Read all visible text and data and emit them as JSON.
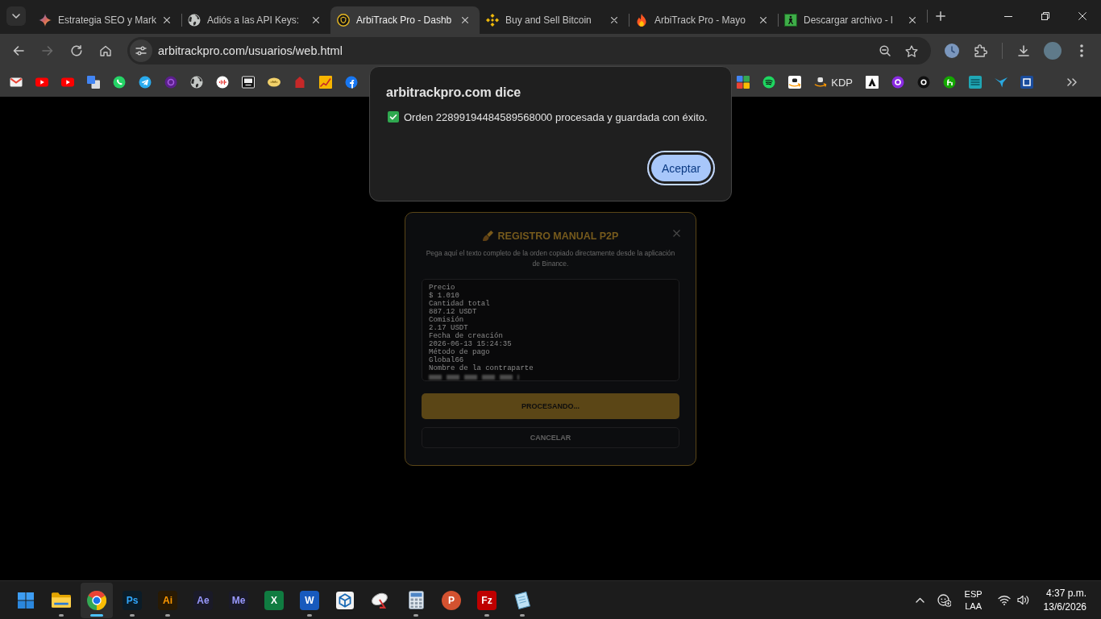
{
  "browser": {
    "tabs": [
      {
        "title": "Estrategia SEO y Mark",
        "selected": false
      },
      {
        "title": "Adiós a las API Keys:",
        "selected": false
      },
      {
        "title": "ArbiTrack Pro - Dashb",
        "selected": true
      },
      {
        "title": "Buy and Sell Bitcoin",
        "selected": false
      },
      {
        "title": "ArbiTrack Pro - Mayo",
        "selected": false
      },
      {
        "title": "Descargar archivo - l",
        "selected": false
      }
    ],
    "toolbar": {
      "forward_disabled": true
    },
    "address_bar": {
      "url": "arbitrackpro.com/usuarios/web.html"
    },
    "bookmarks": [
      {
        "label": "KDP"
      }
    ]
  },
  "alert_dialog": {
    "title": "arbitrackpro.com dice",
    "message": "Orden 22899194484589568000 procesada y guardada con éxito.",
    "button": {
      "label": "Aceptar",
      "focused": true
    }
  },
  "modal": {
    "title": "REGISTRO MANUAL P2P",
    "description": "Pega aquí el texto completo de la orden copiado directamente desde la aplicación de Binance.",
    "order_text": {
      "lines": [
        "Precio",
        "$ 1.010",
        "Cantidad total",
        "887.12 USDT",
        "Comisión",
        "2.17 USDT",
        "Fecha de creación",
        "2026-06-13 15:24:35",
        "Método de pago",
        "Global66",
        "Nombre de la contraparte"
      ]
    },
    "buttons": [
      {
        "label": "PROCESANDO...",
        "kind": "primary"
      },
      {
        "label": "CANCELAR",
        "kind": "secondary"
      }
    ]
  },
  "taskbar": {
    "apps": [
      {
        "kind": "start",
        "running": false,
        "selected": false
      },
      {
        "kind": "folder",
        "running": true,
        "selected": false
      },
      {
        "kind": "ring",
        "running": true,
        "selected": true
      },
      {
        "kind": "adobe",
        "text": "Ps",
        "color": "#31a8ff",
        "running": true,
        "selected": false
      },
      {
        "kind": "adobe",
        "text": "Ai",
        "color": "#ff9a00",
        "running": true,
        "selected": false
      },
      {
        "kind": "adobe",
        "text": "Ae",
        "color": "#9999ff",
        "running": false,
        "selected": false
      },
      {
        "kind": "adobe",
        "text": "Me",
        "color": "#9999ff",
        "running": false,
        "selected": false
      },
      {
        "kind": "tile",
        "text": "X",
        "color": "#107c41",
        "running": false,
        "selected": false
      },
      {
        "kind": "tile",
        "text": "W",
        "color": "#185abd",
        "running": true,
        "selected": false
      },
      {
        "kind": "cube",
        "running": false,
        "selected": false
      },
      {
        "kind": "dish",
        "running": false,
        "selected": false
      },
      {
        "kind": "calculator",
        "running": true,
        "selected": false
      },
      {
        "kind": "disc",
        "text": "P",
        "color": "#d35230",
        "running": false,
        "selected": false
      },
      {
        "kind": "tile",
        "text": "Fz",
        "color": "#bf0000",
        "running": true,
        "selected": false
      },
      {
        "kind": "sheet",
        "running": true,
        "selected": false
      }
    ],
    "tray": {
      "language": "ESP",
      "keyboard": "LAA",
      "time": "4:37 p.m.",
      "date": "13/6/2026"
    }
  }
}
